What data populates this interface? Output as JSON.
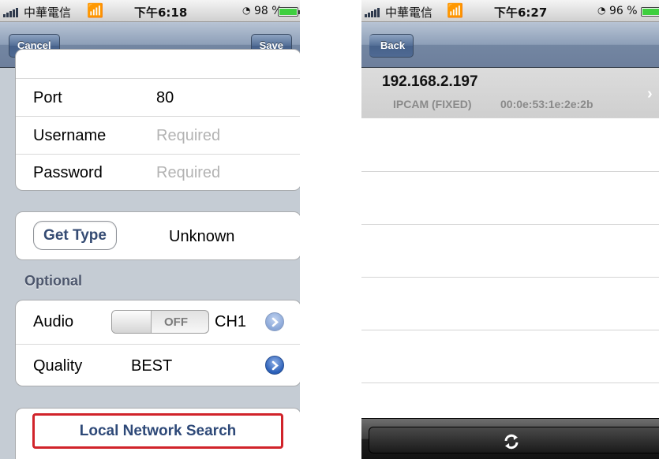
{
  "left_screen": {
    "status_bar": {
      "carrier": "中華電信",
      "time": "下午6:18",
      "battery_text": "98 %",
      "battery_level": 0.98
    },
    "nav": {
      "cancel_label": "Cancel",
      "save_label": "Save"
    },
    "form_rows": {
      "port_label": "Port",
      "port_value": "80",
      "username_label": "Username",
      "username_placeholder": "Required",
      "password_label": "Password",
      "password_placeholder": "Required"
    },
    "get_type": {
      "button_label": "Get Type",
      "value": "Unknown"
    },
    "optional": {
      "header": "Optional",
      "audio_label": "Audio",
      "audio_toggle": "OFF",
      "audio_channel": "CH1",
      "quality_label": "Quality",
      "quality_value": "BEST"
    },
    "local_network_search_label": "Local Network Search"
  },
  "right_screen": {
    "status_bar": {
      "carrier": "中華電信",
      "time": "下午6:27",
      "battery_text": "96 %",
      "battery_level": 0.96
    },
    "nav": {
      "back_label": "Back"
    },
    "devices": [
      {
        "ip": "192.168.2.197",
        "type": "IPCAM (FIXED)",
        "mac": "00:0e:53:1e:2e:2b"
      }
    ],
    "toolbar": {
      "refresh_icon": "refresh-icon"
    }
  }
}
